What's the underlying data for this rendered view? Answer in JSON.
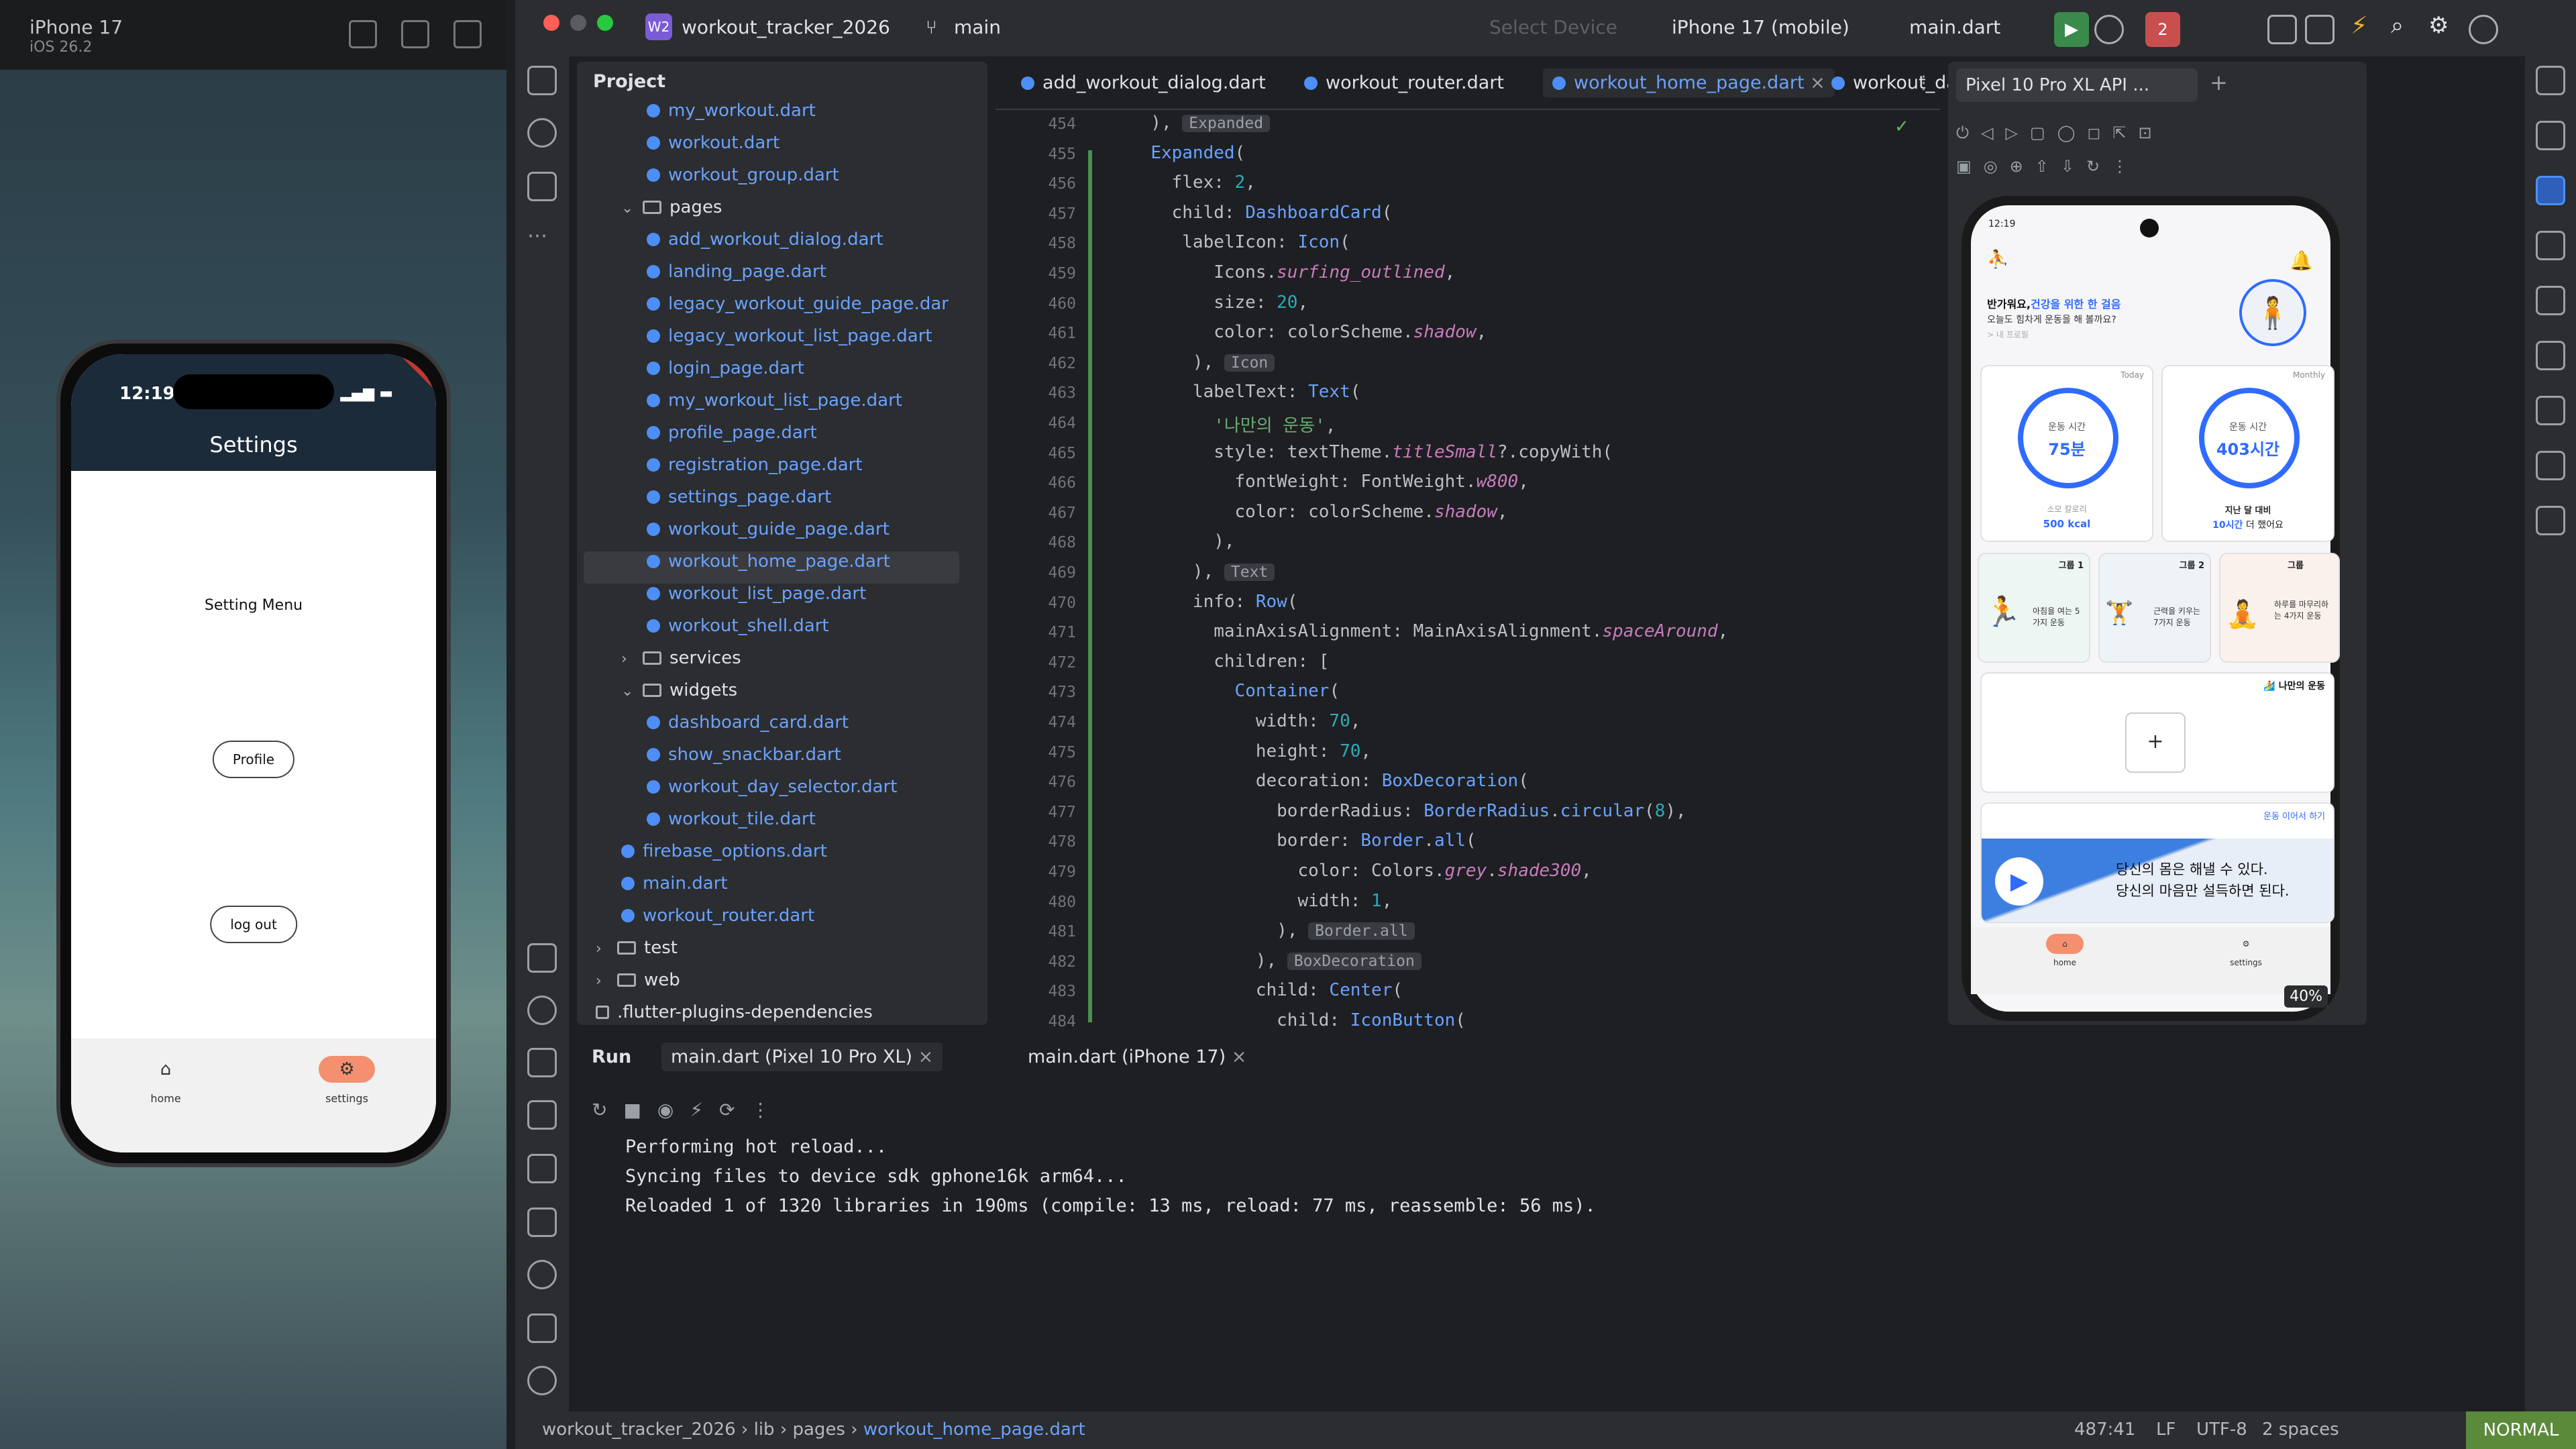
{
  "simulator": {
    "device": "iPhone 17",
    "os": "iOS 26.2",
    "status_time": "12:19",
    "page_title": "Settings",
    "menu_label": "Setting Menu",
    "profile_button": "Profile",
    "logout_button": "log out",
    "nav": [
      {
        "label": "home",
        "icon": "home-icon"
      },
      {
        "label": "settings",
        "icon": "gear-icon"
      }
    ],
    "debug_ribbon": "DEBUG"
  },
  "ide": {
    "project_badge": "W2",
    "project_name": "workout_tracker_2026",
    "branch": "main",
    "device_placeholder": "Select Device",
    "device_selected": "iPhone 17 (mobile)",
    "run_config": "main.dart",
    "run_badge": "2",
    "project_panel": {
      "title": "Project",
      "tree": [
        {
          "name": "my_workout.dart",
          "kind": "dart",
          "depth": 3
        },
        {
          "name": "workout.dart",
          "kind": "dart",
          "depth": 3
        },
        {
          "name": "workout_group.dart",
          "kind": "dart",
          "depth": 3
        },
        {
          "name": "pages",
          "kind": "folder",
          "depth": 2,
          "open": true
        },
        {
          "name": "add_workout_dialog.dart",
          "kind": "dart",
          "depth": 3
        },
        {
          "name": "landing_page.dart",
          "kind": "dart",
          "depth": 3
        },
        {
          "name": "legacy_workout_guide_page.dar",
          "kind": "dart",
          "depth": 3
        },
        {
          "name": "legacy_workout_list_page.dart",
          "kind": "dart",
          "depth": 3
        },
        {
          "name": "login_page.dart",
          "kind": "dart",
          "depth": 3
        },
        {
          "name": "my_workout_list_page.dart",
          "kind": "dart",
          "depth": 3
        },
        {
          "name": "profile_page.dart",
          "kind": "dart",
          "depth": 3
        },
        {
          "name": "registration_page.dart",
          "kind": "dart",
          "depth": 3
        },
        {
          "name": "settings_page.dart",
          "kind": "dart",
          "depth": 3
        },
        {
          "name": "workout_guide_page.dart",
          "kind": "dart",
          "depth": 3
        },
        {
          "name": "workout_home_page.dart",
          "kind": "dart",
          "depth": 3,
          "selected": true
        },
        {
          "name": "workout_list_page.dart",
          "kind": "dart",
          "depth": 3
        },
        {
          "name": "workout_shell.dart",
          "kind": "dart",
          "depth": 3
        },
        {
          "name": "services",
          "kind": "folder",
          "depth": 2,
          "open": false
        },
        {
          "name": "widgets",
          "kind": "folder",
          "depth": 2,
          "open": true
        },
        {
          "name": "dashboard_card.dart",
          "kind": "dart",
          "depth": 3
        },
        {
          "name": "show_snackbar.dart",
          "kind": "dart",
          "depth": 3
        },
        {
          "name": "workout_day_selector.dart",
          "kind": "dart",
          "depth": 3
        },
        {
          "name": "workout_tile.dart",
          "kind": "dart",
          "depth": 3
        },
        {
          "name": "firebase_options.dart",
          "kind": "dart",
          "depth": 2
        },
        {
          "name": "main.dart",
          "kind": "dart",
          "depth": 2
        },
        {
          "name": "workout_router.dart",
          "kind": "dart",
          "depth": 2
        },
        {
          "name": "test",
          "kind": "folder",
          "depth": 1,
          "open": false
        },
        {
          "name": "web",
          "kind": "folder",
          "depth": 1,
          "open": false
        },
        {
          "name": ".flutter-plugins-dependencies",
          "kind": "file",
          "depth": 1
        }
      ]
    },
    "editor_tabs": [
      {
        "name": "add_workout_dialog.dart"
      },
      {
        "name": "workout_router.dart"
      },
      {
        "name": "workout_home_page.dart",
        "active": true
      },
      {
        "name": "workout_day_selec"
      }
    ],
    "code_lines": [
      {
        "n": "454",
        "html": "<span>  ),</span> <span class=\"hint\">Expanded</span>"
      },
      {
        "n": "455",
        "html": "  <span class=\"ty\">Expanded</span>("
      },
      {
        "n": "456",
        "html": "    flex: <span class=\"nm\">2</span>,"
      },
      {
        "n": "457",
        "html": "    child: <span class=\"ty\">DashboardCard</span>("
      },
      {
        "n": "458",
        "html": "     labelIcon: <span class=\"ty\">Icon</span>("
      },
      {
        "n": "459",
        "html": "        Icons.<span class=\"it\">surfing_outlined</span>,"
      },
      {
        "n": "460",
        "html": "        size: <span class=\"nm\">20</span>,"
      },
      {
        "n": "461",
        "html": "        color: colorScheme.<span class=\"it\">shadow</span>,"
      },
      {
        "n": "462",
        "html": "      ), <span class=\"hint\">Icon</span>"
      },
      {
        "n": "463",
        "html": "      labelText: <span class=\"ty\">Text</span>("
      },
      {
        "n": "464",
        "html": "        <span class=\"st\">'나만의 운동'</span>,"
      },
      {
        "n": "465",
        "html": "        style: textTheme.<span class=\"it\">titleSmall</span>?.copyWith("
      },
      {
        "n": "466",
        "html": "          fontWeight: FontWeight.<span class=\"it\">w800</span>,"
      },
      {
        "n": "467",
        "html": "          color: colorScheme.<span class=\"it\">shadow</span>,"
      },
      {
        "n": "468",
        "html": "        ),"
      },
      {
        "n": "469",
        "html": "      ), <span class=\"hint\">Text</span>"
      },
      {
        "n": "470",
        "html": "      info: <span class=\"ty\">Row</span>("
      },
      {
        "n": "471",
        "html": "        mainAxisAlignment: MainAxisAlignment.<span class=\"it\">spaceAround</span>,"
      },
      {
        "n": "472",
        "html": "        children: ["
      },
      {
        "n": "473",
        "html": "          <span class=\"ty\">Container</span>("
      },
      {
        "n": "474",
        "html": "            width: <span class=\"nm\">70</span>,"
      },
      {
        "n": "475",
        "html": "            height: <span class=\"nm\">70</span>,"
      },
      {
        "n": "476",
        "html": "            decoration: <span class=\"ty\">BoxDecoration</span>("
      },
      {
        "n": "477",
        "html": "              borderRadius: <span class=\"ty\">BorderRadius</span>.<span class=\"ty\">circular</span>(<span class=\"nm\">8</span>),"
      },
      {
        "n": "478",
        "html": "              border: <span class=\"ty\">Border</span>.<span class=\"ty\">all</span>("
      },
      {
        "n": "479",
        "html": "                color: Colors.<span class=\"it\">grey</span>.<span class=\"it\">shade300</span>,"
      },
      {
        "n": "480",
        "html": "                width: <span class=\"nm\">1</span>,"
      },
      {
        "n": "481",
        "html": "              ), <span class=\"hint\">Border.all</span>"
      },
      {
        "n": "482",
        "html": "            ), <span class=\"hint\">BoxDecoration</span>"
      },
      {
        "n": "483",
        "html": "            child: <span class=\"ty\">Center</span>("
      },
      {
        "n": "484",
        "html": "              child: <span class=\"ty\">IconButton</span>("
      }
    ],
    "emulator": {
      "tab": "Pixel 10 Pro XL API ...",
      "zoom": "40%",
      "status_time": "12:19",
      "greeting_title": "반가워요,",
      "greeting_sub": "건강을 위한 한 걸음",
      "greeting_line2": "오늘도 힘차게 운동을 해 볼까요?",
      "greeting_line3": "> 내 프로필",
      "today_tag": "Today",
      "today_label": "운동 시간",
      "today_value": "75분",
      "today_foot1": "소모 칼로리",
      "today_foot2": "500 kcal",
      "month_tag": "Monthly",
      "month_label": "운동 시간",
      "month_value": "403시간",
      "month_foot1": "지난 달 대비",
      "month_foot2a": "10시간",
      "month_foot2b": "더 했어요",
      "groups": [
        {
          "title": "그룹 1",
          "text": "아침을 여는 5가지 운동"
        },
        {
          "title": "그룹 2",
          "text": "근력을 키우는 7가지 운동"
        },
        {
          "title": "그룹",
          "text": "하루를 마무리하는 4가지 운동"
        }
      ],
      "my_workout": "나만의 운동",
      "add_symbol": "+",
      "continue_label": "운동 이어서 하기",
      "quote1": "당신의 몸은 해낼 수 있다.",
      "quote2": "당신의 마음만 설득하면 된다.",
      "nav_home": "home",
      "nav_settings": "settings"
    }
  },
  "run_panel": {
    "label": "Run",
    "tabs": [
      {
        "name": "main.dart (Pixel 10 Pro XL)"
      },
      {
        "name": "main.dart (iPhone 17)"
      }
    ],
    "lines": [
      "Performing hot reload...",
      "Syncing files to device sdk gphone16k arm64...",
      "Reloaded 1 of 1320 libraries in 190ms (compile: 13 ms, reload: 77 ms, reassemble: 56 ms)."
    ]
  },
  "statusbar": {
    "crumbs": [
      "workout_tracker_2026",
      "lib",
      "pages",
      "workout_home_page.dart"
    ],
    "position": "487:41",
    "line_sep": "LF",
    "encoding": "UTF-8",
    "indent": "2 spaces",
    "mode": "NORMAL"
  }
}
